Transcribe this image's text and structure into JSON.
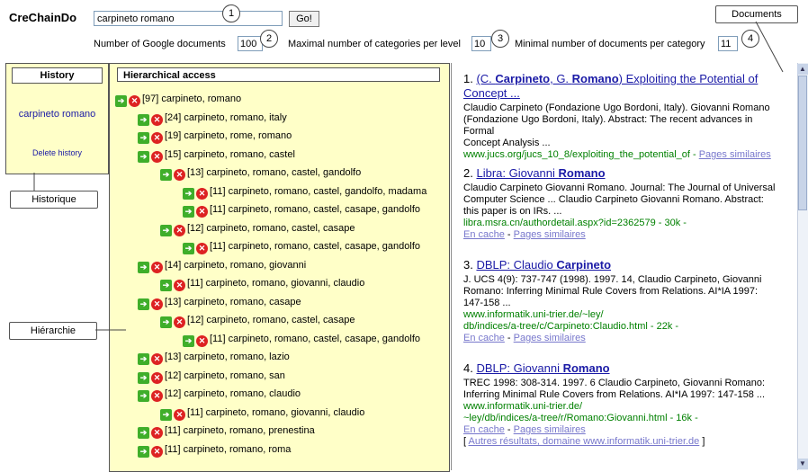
{
  "app": {
    "name": "CreChainDo"
  },
  "search": {
    "query": "carpineto romano",
    "go_label": "Go!"
  },
  "params": [
    {
      "label": "Number of Google documents",
      "value": "100"
    },
    {
      "label": "Maximal number of categories per level",
      "value": "10"
    },
    {
      "label": "Minimal number of documents per category",
      "value": "11"
    }
  ],
  "callouts": {
    "numbers": [
      "1",
      "2",
      "3",
      "4"
    ],
    "documents": "Documents",
    "historique": "Historique",
    "hierarchie": "Hiérarchie"
  },
  "history": {
    "title": "History",
    "item": "carpineto romano",
    "delete": "Delete history"
  },
  "hierarchy": {
    "title": "Hierarchical access",
    "nodes": [
      "[97] carpineto, romano",
      "[24] carpineto, romano, italy",
      "[19] carpineto, rome, romano",
      "[15] carpineto, romano, castel",
      "[13] carpineto, romano, castel, gandolfo",
      "[11] carpineto, romano, castel, gandolfo, madama",
      "[11] carpineto, romano, castel, casape, gandolfo",
      "[12] carpineto, romano, castel, casape",
      "[11] carpineto, romano, castel, casape, gandolfo",
      "[14] carpineto, romano, giovanni",
      "[11] carpineto, romano, giovanni, claudio",
      "[13] carpineto, romano, casape",
      "[12] carpineto, romano, castel, casape",
      "[11] carpineto, romano, castel, casape, gandolfo",
      "[13] carpineto, romano, lazio",
      "[12] carpineto, romano, san",
      "[12] carpineto, romano, claudio",
      "[11] carpineto, romano, giovanni, claudio",
      "[11] carpineto, romano, prenestina",
      "[11] carpineto, romano, roma"
    ]
  },
  "results": [
    {
      "num": "1.",
      "title_a": "(C. ",
      "title_b": "Carpineto",
      "title_c": ", G. ",
      "title_d": "Romano",
      "title_e": ") Exploiting the Potential of",
      "title_f": "Concept ...",
      "snip1": "Claudio Carpineto (Fondazione Ugo Bordoni, Italy). Giovanni Romano",
      "snip2": "(Fondazione Ugo Bordoni, Italy). Abstract: The recent advances in Formal",
      "snip3": "Concept Analysis ...",
      "url": "www.jucs.org/jucs_10_8/exploiting_the_potential_of - ",
      "similar": "Pages similaires"
    },
    {
      "num": "2.",
      "title_a": "Libra: Giovanni ",
      "title_b": "Romano",
      "snip1": "Claudio Carpineto Giovanni Romano. Journal: The Journal of Universal",
      "snip2": "Computer Science ... Claudio Carpineto Giovanni Romano. Abstract:",
      "snip3": "this paper is on IRs. ...",
      "url": "libra.msra.cn/authordetail.aspx?id=2362579 - 30k -",
      "cache": "En cache",
      "sep": " - ",
      "similar": "Pages similaires"
    },
    {
      "num": "3.",
      "title_a": "DBLP: Claudio ",
      "title_b": "Carpineto",
      "snip1": "J. UCS 4(9): 737-747 (1998). 1997. 14, Claudio Carpineto, Giovanni",
      "snip2": "Romano: Inferring Minimal Rule Covers from Relations. AI*IA 1997:",
      "snip3": "147-158 ...",
      "url1": "www.informatik.uni-trier.de/~ley/",
      "url2": "db/indices/a-tree/c/Carpineto:Claudio.html - 22k -",
      "cache": "En cache",
      "sep": " - ",
      "similar": "Pages similaires"
    },
    {
      "num": "4.",
      "title_a": "DBLP: Giovanni ",
      "title_b": "Romano",
      "snip1": "TREC 1998: 308-314. 1997. 6 Claudio Carpineto, Giovanni Romano:",
      "snip2": "Inferring Minimal Rule Covers from Relations. AI*IA 1997: 147-158 ...",
      "url1": "www.informatik.uni-trier.de/",
      "url2": "~ley/db/indices/a-tree/r/Romano:Giovanni.html - 16k -",
      "cache": "En cache",
      "sep": " - ",
      "similar": "Pages similaires",
      "more": "Autres résultats, domaine www.informatik.uni-trier.de",
      "bracket_open": "[ ",
      "bracket_close": " ]"
    }
  ],
  "icons": {
    "expand": "expand-arrow-icon",
    "remove": "remove-x-icon"
  }
}
